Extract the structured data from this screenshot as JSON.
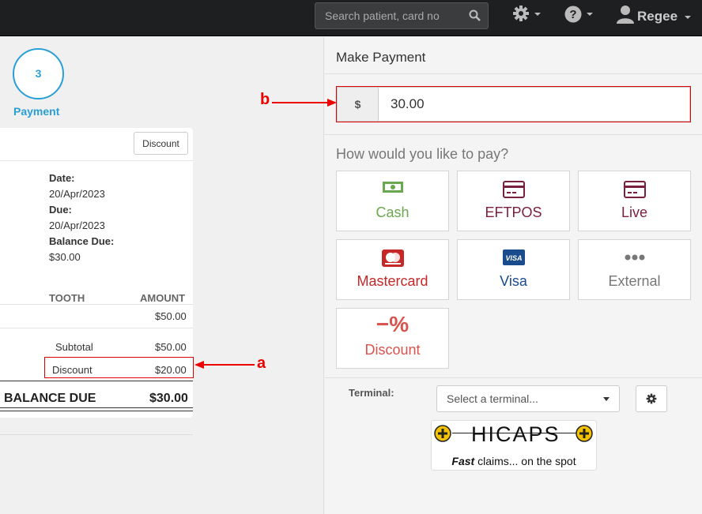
{
  "header": {
    "search_placeholder": "Search patient, card no",
    "user_name": "Regee",
    "icons": [
      "search-icon",
      "gear-icon",
      "help-icon",
      "user-icon"
    ]
  },
  "steps": {
    "number": "3",
    "label": "Payment"
  },
  "invoice": {
    "discount_button": "Discount",
    "date_label": "Date:",
    "date_value": "20/Apr/2023",
    "due_label": "Due:",
    "due_value": "20/Apr/2023",
    "balance_due_label": "Balance Due:",
    "balance_due_value": "$30.00"
  },
  "items": {
    "col_tooth": "TOOTH",
    "col_amount": "AMOUNT",
    "row_amount": "$50.00",
    "subtotal_label": "Subtotal",
    "subtotal_value": "$50.00",
    "discount_label": "Discount",
    "discount_value": "$20.00",
    "balance_label": "BALANCE DUE",
    "balance_value": "$30.00"
  },
  "payment": {
    "title": "Make Payment",
    "currency_symbol": "$",
    "amount": "30.00",
    "prompt": "How would you like to pay?",
    "methods": [
      {
        "label": "Cash",
        "color": "#6aa84f"
      },
      {
        "label": "EFTPOS",
        "color": "#7a1f3d"
      },
      {
        "label": "Live",
        "color": "#7a1f3d"
      },
      {
        "label": "Mastercard",
        "color": "#c62828"
      },
      {
        "label": "Visa",
        "color": "#1a4b8c"
      },
      {
        "label": "External",
        "color": "#777777"
      },
      {
        "label": "Discount",
        "color": "#d9534f",
        "icon_text": "−%"
      }
    ],
    "terminal_label": "Terminal:",
    "terminal_placeholder": "Select a terminal...",
    "hicaps_word": "HICAPS",
    "hicaps_tag_bold": "Fast",
    "hicaps_tag_rest": " claims... on the spot"
  },
  "annotations": {
    "a": "a",
    "b": "b",
    "color": "#e00000"
  }
}
